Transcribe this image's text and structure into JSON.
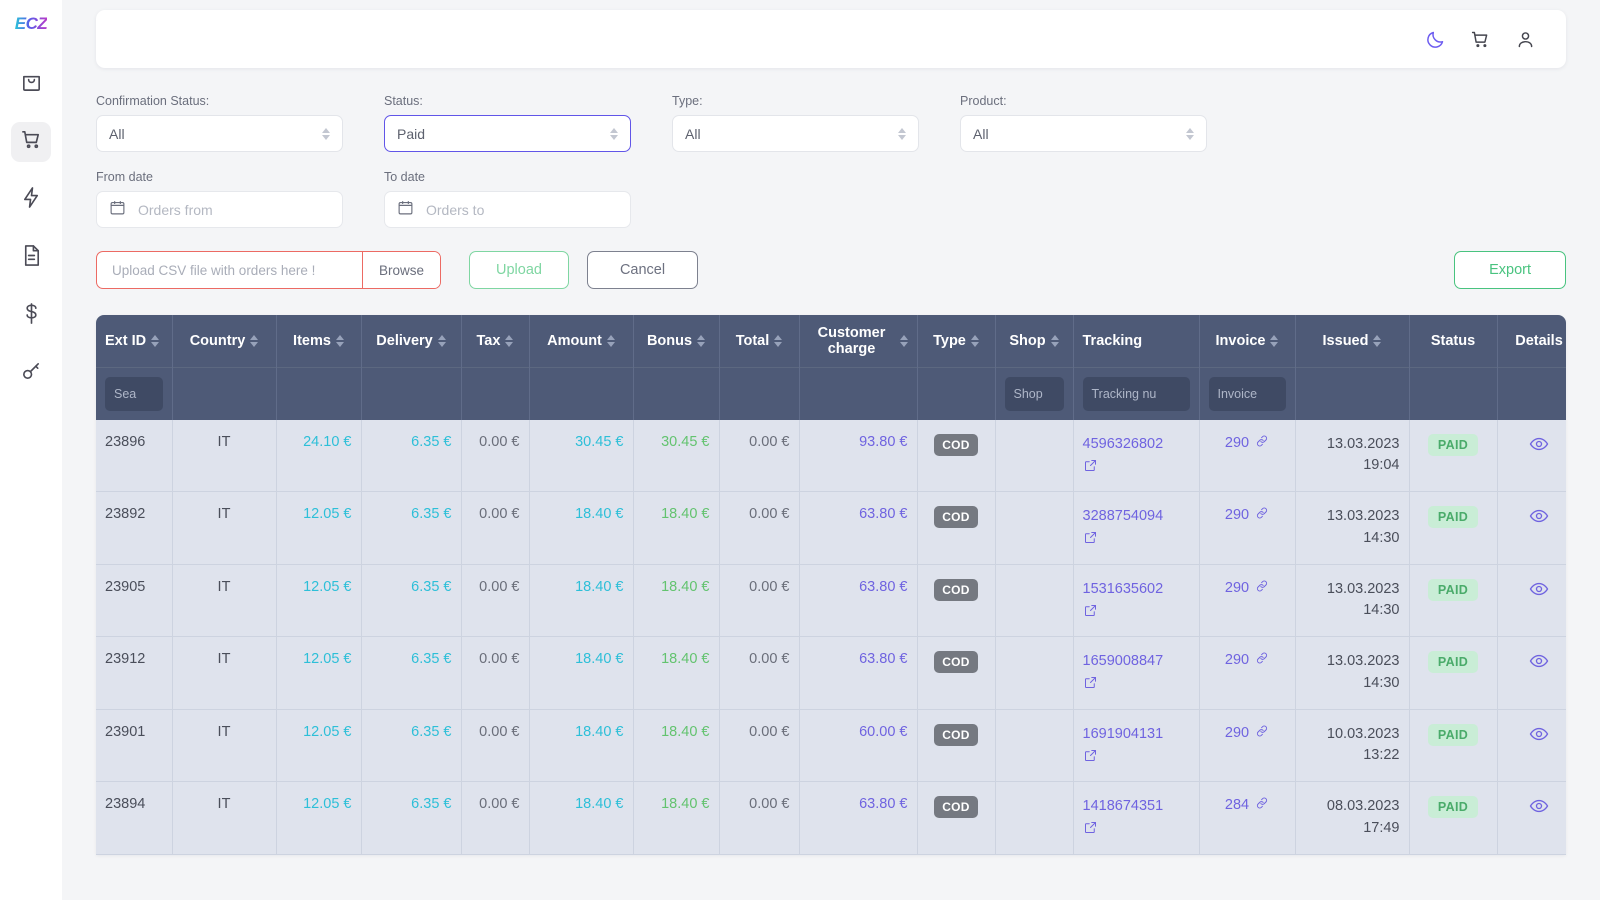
{
  "sidebar": {
    "logo": "ECZ",
    "items": [
      {
        "name": "shopping-bag-icon",
        "active": false
      },
      {
        "name": "cart-icon",
        "active": true
      },
      {
        "name": "lightning-bolt-icon",
        "active": false
      },
      {
        "name": "document-icon",
        "active": false
      },
      {
        "name": "dollar-icon",
        "active": false
      },
      {
        "name": "key-icon",
        "active": false
      }
    ]
  },
  "topbar": {
    "icons": [
      "moon-icon",
      "cart-icon",
      "user-icon"
    ]
  },
  "filters": {
    "confirmation_status": {
      "label": "Confirmation Status:",
      "value": "All"
    },
    "status": {
      "label": "Status:",
      "value": "Paid"
    },
    "type": {
      "label": "Type:",
      "value": "All"
    },
    "product": {
      "label": "Product:",
      "value": "All"
    },
    "from_date": {
      "label": "From date",
      "placeholder": "Orders from",
      "value": ""
    },
    "to_date": {
      "label": "To date",
      "placeholder": "Orders to",
      "value": ""
    }
  },
  "actions": {
    "upload_placeholder": "Upload CSV file with orders here !",
    "browse_label": "Browse",
    "upload_label": "Upload",
    "cancel_label": "Cancel",
    "export_label": "Export"
  },
  "table": {
    "columns": [
      {
        "label": "Ext ID",
        "sortable": true
      },
      {
        "label": "Country",
        "sortable": true
      },
      {
        "label": "Items",
        "sortable": true
      },
      {
        "label": "Delivery",
        "sortable": true
      },
      {
        "label": "Tax",
        "sortable": true
      },
      {
        "label": "Amount",
        "sortable": true
      },
      {
        "label": "Bonus",
        "sortable": true
      },
      {
        "label": "Total",
        "sortable": true
      },
      {
        "label": "Customer charge",
        "sortable": true
      },
      {
        "label": "Type",
        "sortable": true
      },
      {
        "label": "Shop",
        "sortable": true
      },
      {
        "label": "Tracking",
        "sortable": false
      },
      {
        "label": "Invoice",
        "sortable": true
      },
      {
        "label": "Issued",
        "sortable": true
      },
      {
        "label": "Status",
        "sortable": false
      },
      {
        "label": "Details",
        "sortable": false
      }
    ],
    "column_filters": {
      "ext_id_placeholder": "Sea",
      "shop_placeholder": "Shop",
      "tracking_placeholder": "Tracking nu",
      "invoice_placeholder": "Invoice"
    },
    "rows": [
      {
        "ext_id": "23896",
        "country": "IT",
        "items": "24.10 €",
        "delivery": "6.35 €",
        "tax": "0.00 €",
        "amount": "30.45 €",
        "bonus": "30.45 €",
        "total": "0.00 €",
        "customer_charge": "93.80 €",
        "type": "COD",
        "shop": "",
        "tracking": "4596326802",
        "invoice": "290",
        "issued_date": "13.03.2023",
        "issued_time": "19:04",
        "status": "PAID"
      },
      {
        "ext_id": "23892",
        "country": "IT",
        "items": "12.05 €",
        "delivery": "6.35 €",
        "tax": "0.00 €",
        "amount": "18.40 €",
        "bonus": "18.40 €",
        "total": "0.00 €",
        "customer_charge": "63.80 €",
        "type": "COD",
        "shop": "",
        "tracking": "3288754094",
        "invoice": "290",
        "issued_date": "13.03.2023",
        "issued_time": "14:30",
        "status": "PAID"
      },
      {
        "ext_id": "23905",
        "country": "IT",
        "items": "12.05 €",
        "delivery": "6.35 €",
        "tax": "0.00 €",
        "amount": "18.40 €",
        "bonus": "18.40 €",
        "total": "0.00 €",
        "customer_charge": "63.80 €",
        "type": "COD",
        "shop": "",
        "tracking": "1531635602",
        "invoice": "290",
        "issued_date": "13.03.2023",
        "issued_time": "14:30",
        "status": "PAID"
      },
      {
        "ext_id": "23912",
        "country": "IT",
        "items": "12.05 €",
        "delivery": "6.35 €",
        "tax": "0.00 €",
        "amount": "18.40 €",
        "bonus": "18.40 €",
        "total": "0.00 €",
        "customer_charge": "63.80 €",
        "type": "COD",
        "shop": "",
        "tracking": "1659008847",
        "invoice": "290",
        "issued_date": "13.03.2023",
        "issued_time": "14:30",
        "status": "PAID"
      },
      {
        "ext_id": "23901",
        "country": "IT",
        "items": "12.05 €",
        "delivery": "6.35 €",
        "tax": "0.00 €",
        "amount": "18.40 €",
        "bonus": "18.40 €",
        "total": "0.00 €",
        "customer_charge": "60.00 €",
        "type": "COD",
        "shop": "",
        "tracking": "1691904131",
        "invoice": "290",
        "issued_date": "10.03.2023",
        "issued_time": "13:22",
        "status": "PAID"
      },
      {
        "ext_id": "23894",
        "country": "IT",
        "items": "12.05 €",
        "delivery": "6.35 €",
        "tax": "0.00 €",
        "amount": "18.40 €",
        "bonus": "18.40 €",
        "total": "0.00 €",
        "customer_charge": "63.80 €",
        "type": "COD",
        "shop": "",
        "tracking": "1418674351",
        "invoice": "284",
        "issued_date": "08.03.2023",
        "issued_time": "17:49",
        "status": "PAID"
      }
    ]
  },
  "colors": {
    "accent_purple": "#6f63e0",
    "cyan": "#2dbfd8",
    "green": "#63c36f",
    "header_bg": "#4e5a77",
    "row_bg": "#dfe3ed",
    "danger": "#ec6a63"
  }
}
